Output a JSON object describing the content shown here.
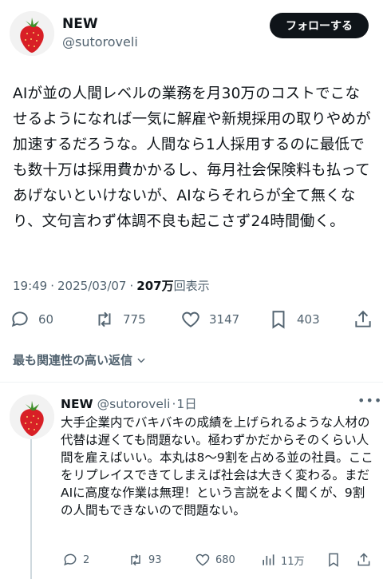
{
  "tweet": {
    "author_name": "NEW",
    "author_handle": "@sutoroveli",
    "follow_label": "フォローする",
    "text": "AIが並の人間レベルの業務を月30万のコストでこなせるようになれば一気に解雇や新規採用の取りやめが加速するだろうな。人間なら1人採用するのに最低でも数十万は採用費かかるし、毎月社会保険料も払ってあげないといけないが、AIならそれらが全て無くなり、文句言わず体調不良も起こさず24時間働く。",
    "time": "19:49",
    "separator": "·",
    "date": "2025/03/07",
    "views_count": "207万",
    "views_label": "回表示",
    "replies": "60",
    "retweets": "775",
    "likes": "3147",
    "bookmarks": "403"
  },
  "sort": {
    "label": "最も関連性の高い返信"
  },
  "reply": {
    "author_name": "NEW",
    "author_handle": "@sutoroveli",
    "separator": "·",
    "age": "1日",
    "text": "大手企業内でバキバキの成績を上げられるような人材の代替は遅くても問題ない。極わずかだからそのくらい人間を雇えばいい。本丸は8〜9割を占める並の社員。ここをリプレイスできてしまえば社会は大きく変わる。まだAIに高度な作業は無理！という言説をよく聞くが、9割の人間もできないので問題ない。",
    "replies": "2",
    "retweets": "93",
    "likes": "680",
    "views": "11万"
  },
  "colors": {
    "text": "#0f1419",
    "secondary": "#536471",
    "follow_bg": "#0f1419",
    "strawberry": "#d81f26",
    "leaf": "#3f8f2a"
  },
  "icons": {
    "avatar": "strawberry-avatar",
    "reply": "speech-bubble-icon",
    "retweet": "retweet-arrows-icon",
    "like": "heart-icon",
    "bookmark": "bookmark-icon",
    "share": "share-upload-icon",
    "views": "bar-chart-icon",
    "more": "more-dots-icon",
    "chevron": "chevron-down-icon"
  }
}
